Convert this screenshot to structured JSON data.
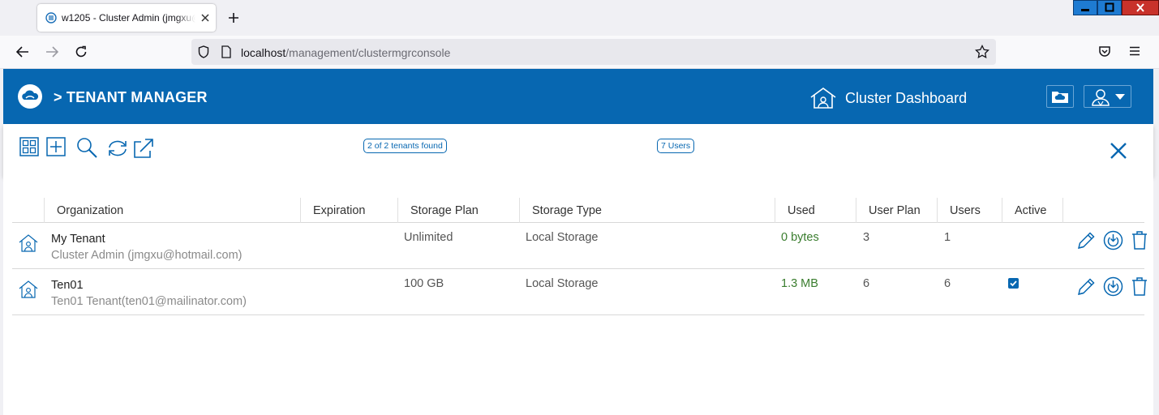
{
  "browser": {
    "tab_title": "w1205 - Cluster Admin (jmgxu@hotmail.com)",
    "url_host": "localhost",
    "url_path": "/management/clustermgrconsole"
  },
  "header": {
    "title": "> TENANT MANAGER",
    "dashboard_label": "Cluster Dashboard"
  },
  "toolbar": {
    "tenants_found": "2 of 2 tenants found",
    "users_count": "7 Users"
  },
  "table": {
    "columns": [
      "Organization",
      "Expiration",
      "Storage Plan",
      "Storage Type",
      "Used",
      "User Plan",
      "Users",
      "Active"
    ],
    "rows": [
      {
        "name": "My Tenant",
        "owner": "Cluster Admin (jmgxu@hotmail.com)",
        "expiration": "",
        "storage_plan": "Unlimited",
        "storage_type": "Local Storage",
        "used": "0 bytes",
        "user_plan": "3",
        "users": "1",
        "active": false
      },
      {
        "name": "Ten01",
        "owner": "Ten01 Tenant(ten01@mailinator.com)",
        "expiration": "",
        "storage_plan": "100 GB",
        "storage_type": "Local Storage",
        "used": "1.3 MB",
        "user_plan": "6",
        "users": "6",
        "active": true
      }
    ]
  },
  "colors": {
    "brand_blue": "#0767b1",
    "used_green": "#3a7d2e"
  },
  "icons": {
    "toolbar": [
      "grid-view-icon",
      "add-icon",
      "search-icon",
      "refresh-icon",
      "export-icon",
      "close-icon"
    ],
    "row_actions": [
      "edit-icon",
      "storage-icon",
      "delete-icon"
    ]
  }
}
